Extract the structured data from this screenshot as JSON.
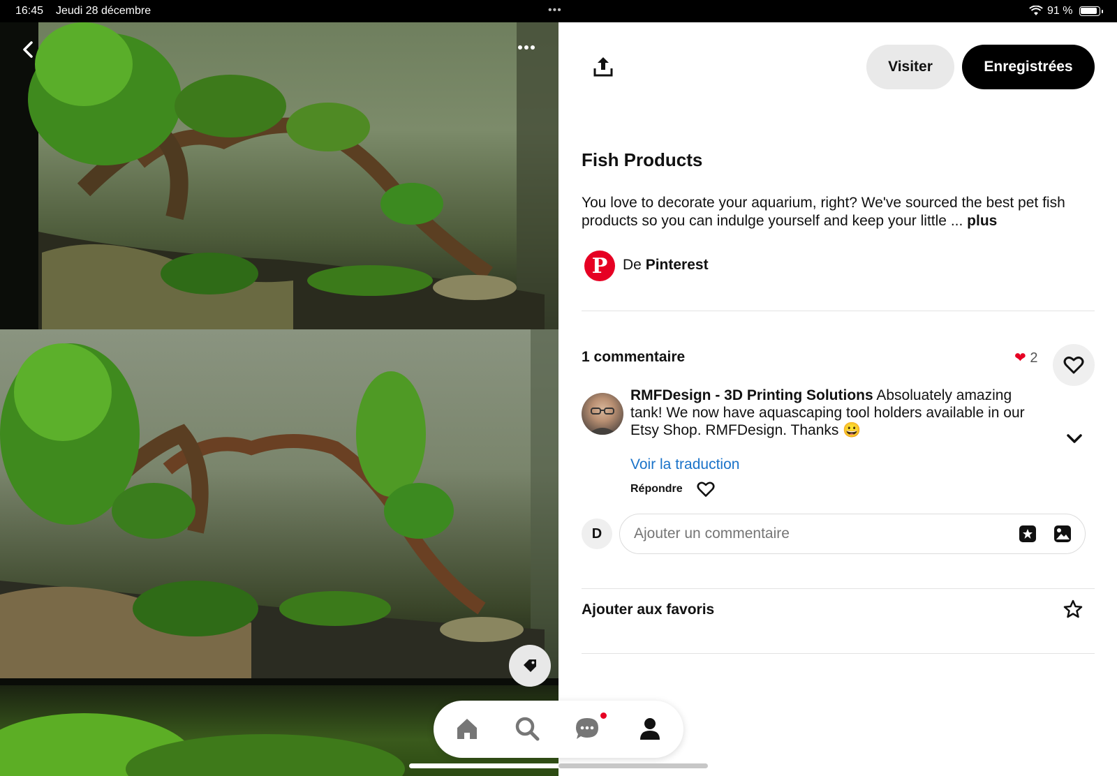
{
  "status_bar": {
    "time": "16:45",
    "date": "Jeudi 28 décembre",
    "battery": "91 %"
  },
  "pin": {
    "title": "Fish Products",
    "description": "You love to decorate your aquarium, right? We've sourced the best pet fish products so you can indulge yourself and keep your little ...",
    "more_label": "plus",
    "source_prefix": "De",
    "source_name": "Pinterest"
  },
  "actions": {
    "visit_label": "Visiter",
    "saved_label": "Enregistrées"
  },
  "comments": {
    "title": "1 commentaire",
    "reaction_count": "2",
    "items": [
      {
        "author": "RMFDesign - 3D Printing Solutions",
        "text": "Absoluately amazing tank! We now have aquascaping tool holders available in our Etsy Shop. RMFDesign. Thanks 😀",
        "translate_label": "Voir la traduction",
        "reply_label": "Répondre"
      }
    ],
    "user_initial": "D",
    "input_placeholder": "Ajouter un commentaire"
  },
  "favorites": {
    "label": "Ajouter aux favoris"
  },
  "colors": {
    "brand_red": "#e60023",
    "link_blue": "#1a73c9"
  },
  "icons": {
    "back": "chevron-left-icon",
    "more": "ellipsis-icon",
    "tag": "tag-icon",
    "share": "share-icon",
    "heart": "heart-icon",
    "chevron_down": "chevron-down-icon",
    "sticker": "sticker-icon",
    "image": "image-icon",
    "star": "star-icon",
    "home": "home-icon",
    "search": "search-icon",
    "messages": "chat-icon",
    "profile": "profile-icon"
  }
}
